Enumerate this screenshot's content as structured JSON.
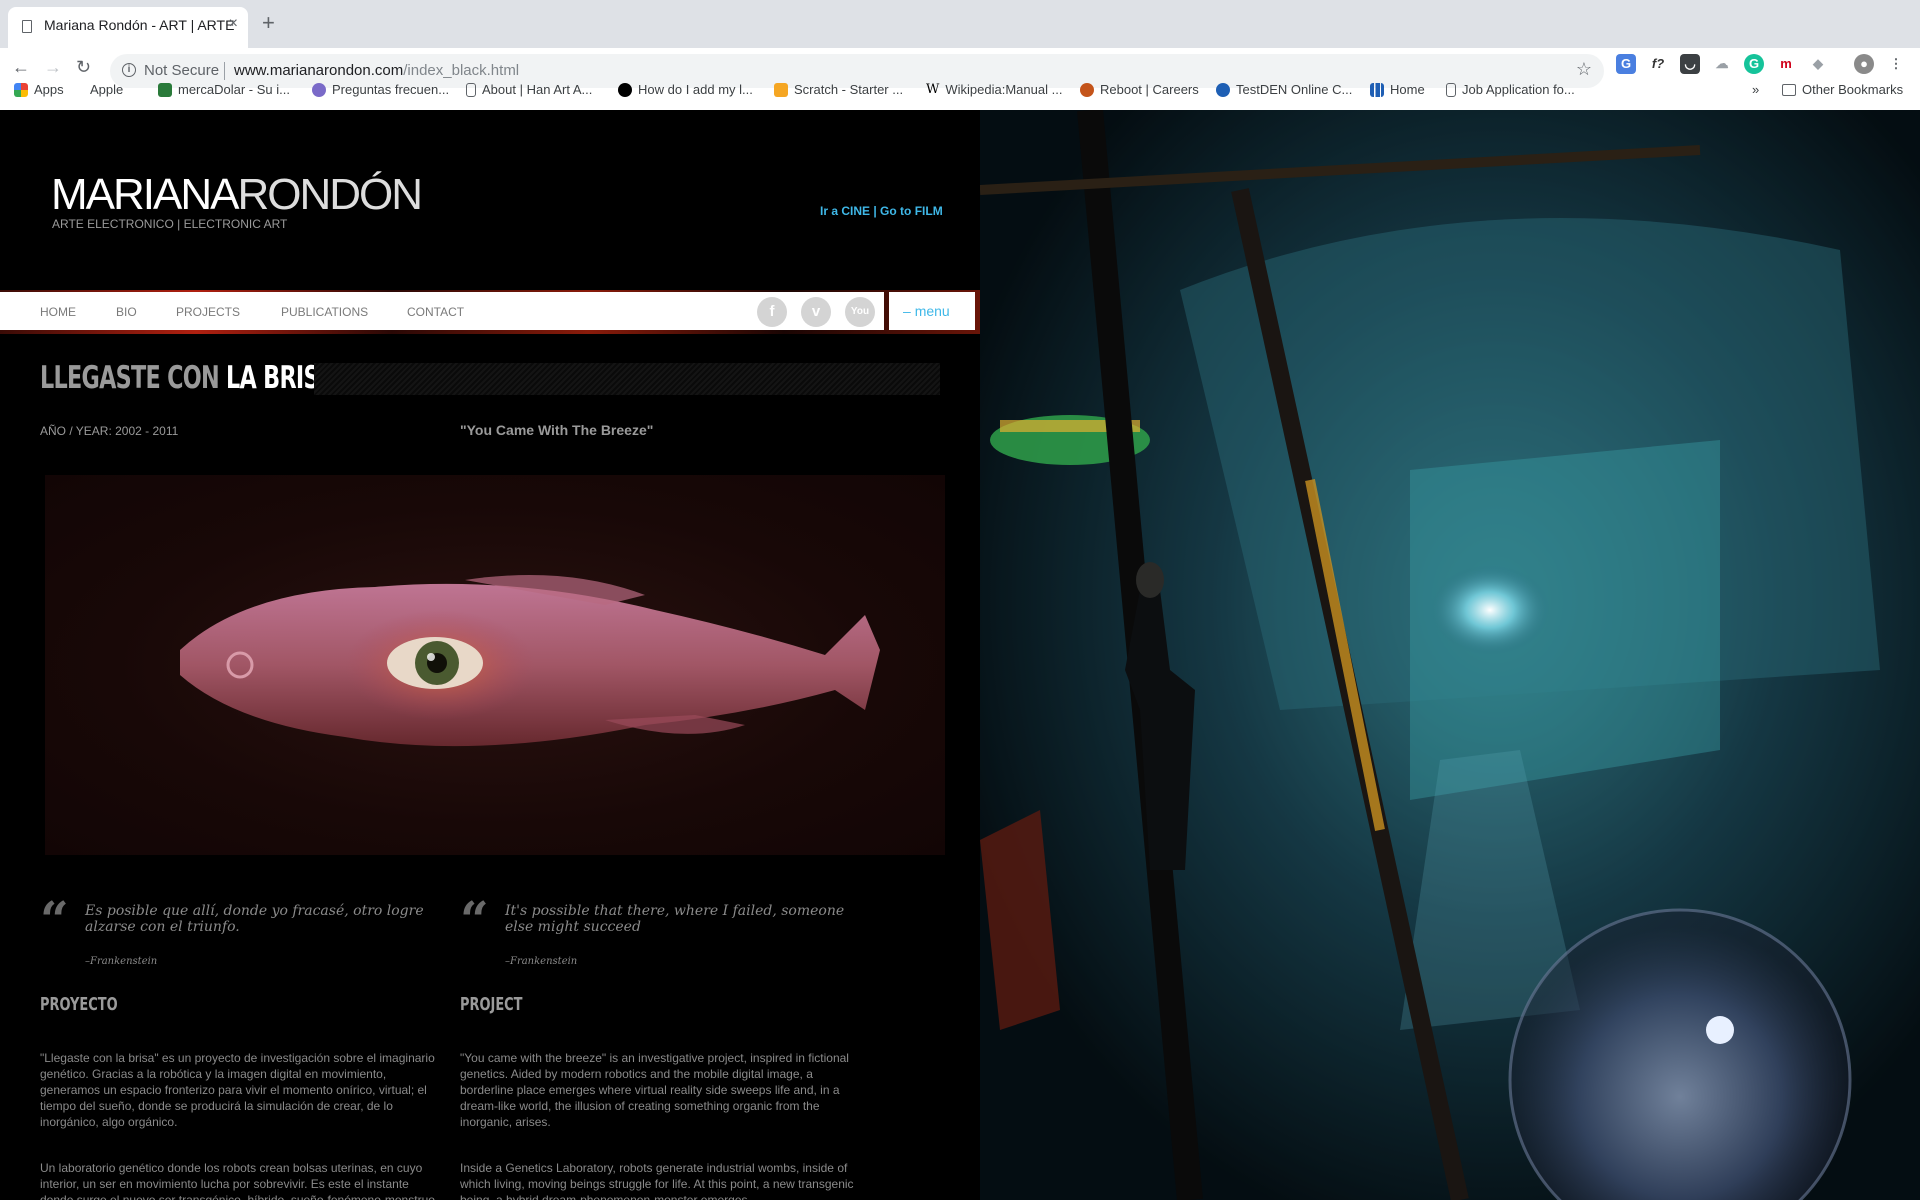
{
  "browser": {
    "tab_title": "Mariana Rondón - ART | ARTE",
    "tab_close": "×",
    "new_tab": "+",
    "not_secure": "Not Secure",
    "url_host": "www.marianarondon.com",
    "url_path": "/index_black.html",
    "bookmarks": [
      "Apps",
      "Apple",
      "mercaDolar - Su i...",
      "Preguntas frecuen...",
      "About | Han Art A...",
      "How do I add my l...",
      "Scratch - Starter ...",
      "Wikipedia:Manual ...",
      "Reboot | Careers",
      "TestDEN Online C...",
      "Home",
      "Job Application fo..."
    ],
    "more_bookmarks": "»",
    "other_bookmarks": "Other Bookmarks"
  },
  "site": {
    "logo_part1": "MARIANA",
    "logo_part2": "RONDÓN",
    "tagline": "ARTE ELECTRONICO | ELECTRONIC ART",
    "go_film": "Ir a CINE | Go to FILM",
    "nav": [
      "HOME",
      "BIO",
      "PROJECTS",
      "PUBLICATIONS",
      "CONTACT"
    ],
    "social": [
      "f",
      "v",
      "You"
    ],
    "menu": "menu",
    "menu_icon": "–"
  },
  "project": {
    "title_part1": "LLEGASTE CON",
    "title_part2": "LA BRISA",
    "year": "AÑO / YEAR: 2002 - 2011",
    "subtitle_en": "\"You Came With The Breeze\"",
    "quote_es": "Es posible que allí, donde yo fracasé, otro logre alzarse con el triunfo.",
    "quote_en": "It's possible that there, where I failed, someone else might succeed",
    "quote_author": "–Frankenstein",
    "quote_mark": "“",
    "section_es": "PROYECTO",
    "section_en": "PROJECT",
    "para1_es": "\"Llegaste con la brisa\" es un proyecto de investigación sobre el imaginario genético. Gracias a la robótica y la imagen digital en movimiento, generamos un espacio fronterizo para vivir el momento onírico, virtual; el tiempo del sueño, donde se producirá la simulación de crear, de lo inorgánico, algo orgánico.",
    "para1_en": "\"You came with the breeze\" is an investigative project, inspired in fictional genetics. Aided by modern robotics and the mobile digital image, a borderline place emerges where virtual reality side sweeps life and, in a dream-like world, the illusion of creating something organic from the inorganic, arises.",
    "para2_es": "Un laboratorio genético donde los robots crean bolsas uterinas, en cuyo interior, un ser en movimiento lucha por sobrevivir. Es este el instante donde surge el nuevo ser transgénico, híbrido, sueño-fenómeno-monstruo.",
    "para2_en": "Inside a Genetics Laboratory, robots generate industrial wombs, inside of which living, moving beings struggle for life. At this point, a new transgenic being, a hybrid dream-phenomenon-monster emerges."
  }
}
